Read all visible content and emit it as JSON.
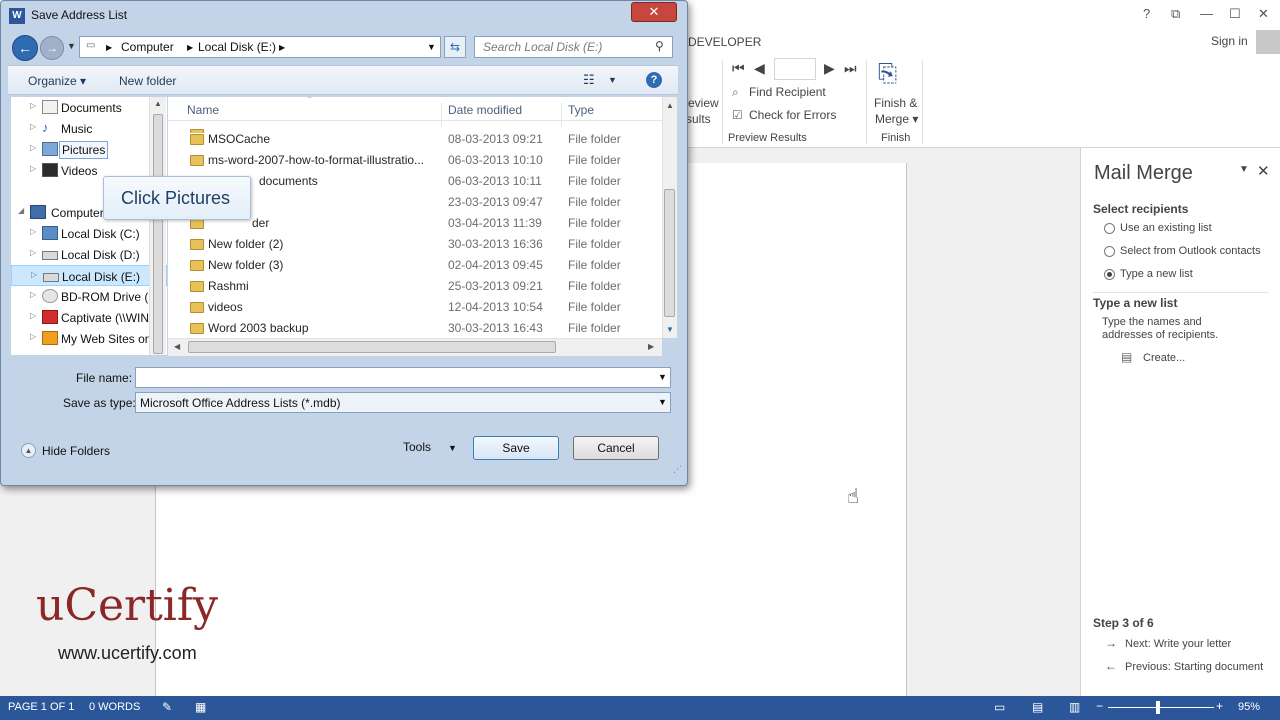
{
  "word": {
    "tab_developer": "DEVELOPER",
    "sign_in": "Sign in",
    "window_controls": [
      "?",
      "⧉",
      "—",
      "☐",
      "✕"
    ],
    "ribbon": {
      "preview_partial": [
        "eview",
        "sults"
      ],
      "find_recipient": "Find Recipient",
      "check_errors": "Check for Errors",
      "preview_results_group": "Preview Results",
      "finish_merge": [
        "Finish &",
        "Merge ▾"
      ],
      "finish_group": "Finish"
    }
  },
  "mail_merge": {
    "title": "Mail Merge",
    "select_recipients_heading": "Select recipients",
    "options": [
      {
        "label": "Use an existing list",
        "selected": false
      },
      {
        "label": "Select from Outlook contacts",
        "selected": false
      },
      {
        "label": "Type a new list",
        "selected": true
      }
    ],
    "type_new_list_heading": "Type a new list",
    "type_new_list_desc": [
      "Type the names and",
      "addresses of recipients."
    ],
    "create_link": "Create...",
    "step": "Step 3 of 6",
    "next_link": "Next: Write your letter",
    "previous_link": "Previous: Starting document"
  },
  "status_bar": {
    "page": "PAGE 1 OF 1",
    "words": "0 WORDS",
    "zoom": "95%"
  },
  "watermark": {
    "logo": "uCertify",
    "url": "www.ucertify.com"
  },
  "dialog": {
    "title": "Save Address List",
    "breadcrumb": [
      "Computer",
      "Local Disk (E:)"
    ],
    "search_placeholder": "Search Local Disk (E:)",
    "toolbar": {
      "organize": "Organize ▾",
      "new_folder": "New folder"
    },
    "tree": [
      {
        "label": "Documents",
        "icon": "documents-icon"
      },
      {
        "label": "Music",
        "icon": "music-icon"
      },
      {
        "label": "Pictures",
        "icon": "pictures-icon"
      },
      {
        "label": "Videos",
        "icon": "videos-icon"
      },
      {
        "label": "Computer",
        "icon": "computer-icon"
      },
      {
        "label": "Local Disk (C:)",
        "icon": "drive-icon"
      },
      {
        "label": "Local Disk (D:)",
        "icon": "drive-icon"
      },
      {
        "label": "Local Disk (E:)",
        "icon": "drive-icon",
        "selected": true
      },
      {
        "label": "BD-ROM Drive (H",
        "icon": "disc-icon"
      },
      {
        "label": "Captivate (\\\\WIN",
        "icon": "network-drive-icon"
      },
      {
        "label": "My Web Sites on",
        "icon": "web-sites-icon"
      }
    ],
    "columns": [
      "Name",
      "Date modified",
      "Type"
    ],
    "files": [
      {
        "name": "MSOCache",
        "date": "08-03-2013 09:21",
        "type": "File folder"
      },
      {
        "name": "ms-word-2007-how-to-format-illustratio...",
        "date": "06-03-2013 10:10",
        "type": "File folder"
      },
      {
        "name": "documents",
        "date": "06-03-2013 10:11",
        "type": "File folder"
      },
      {
        "name": "",
        "date": "23-03-2013 09:47",
        "type": "File folder"
      },
      {
        "name": "der",
        "date": "03-04-2013 11:39",
        "type": "File folder"
      },
      {
        "name": "New folder (2)",
        "date": "30-03-2013 16:36",
        "type": "File folder"
      },
      {
        "name": "New folder (3)",
        "date": "02-04-2013 09:45",
        "type": "File folder"
      },
      {
        "name": "Rashmi",
        "date": "25-03-2013 09:21",
        "type": "File folder"
      },
      {
        "name": "videos",
        "date": "12-04-2013 10:54",
        "type": "File folder"
      },
      {
        "name": "Word 2003 backup",
        "date": "30-03-2013 16:43",
        "type": "File folder"
      }
    ],
    "callout": "Click Pictures",
    "file_name_label": "File name:",
    "file_name_value": "",
    "save_as_type_label": "Save as type:",
    "save_as_type_value": "Microsoft Office Address Lists (*.mdb)",
    "hide_folders": "Hide Folders",
    "tools": "Tools",
    "save": "Save",
    "cancel": "Cancel"
  }
}
